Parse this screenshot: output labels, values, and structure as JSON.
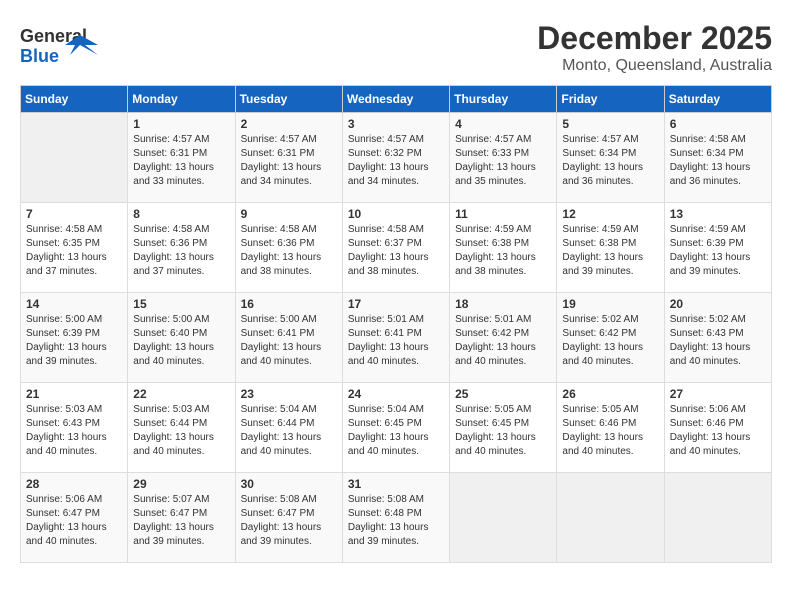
{
  "header": {
    "logo_line1": "General",
    "logo_line2": "Blue",
    "month": "December 2025",
    "location": "Monto, Queensland, Australia"
  },
  "weekdays": [
    "Sunday",
    "Monday",
    "Tuesday",
    "Wednesday",
    "Thursday",
    "Friday",
    "Saturday"
  ],
  "weeks": [
    [
      {
        "day": "",
        "info": ""
      },
      {
        "day": "1",
        "info": "Sunrise: 4:57 AM\nSunset: 6:31 PM\nDaylight: 13 hours\nand 33 minutes."
      },
      {
        "day": "2",
        "info": "Sunrise: 4:57 AM\nSunset: 6:31 PM\nDaylight: 13 hours\nand 34 minutes."
      },
      {
        "day": "3",
        "info": "Sunrise: 4:57 AM\nSunset: 6:32 PM\nDaylight: 13 hours\nand 34 minutes."
      },
      {
        "day": "4",
        "info": "Sunrise: 4:57 AM\nSunset: 6:33 PM\nDaylight: 13 hours\nand 35 minutes."
      },
      {
        "day": "5",
        "info": "Sunrise: 4:57 AM\nSunset: 6:34 PM\nDaylight: 13 hours\nand 36 minutes."
      },
      {
        "day": "6",
        "info": "Sunrise: 4:58 AM\nSunset: 6:34 PM\nDaylight: 13 hours\nand 36 minutes."
      }
    ],
    [
      {
        "day": "7",
        "info": "Sunrise: 4:58 AM\nSunset: 6:35 PM\nDaylight: 13 hours\nand 37 minutes."
      },
      {
        "day": "8",
        "info": "Sunrise: 4:58 AM\nSunset: 6:36 PM\nDaylight: 13 hours\nand 37 minutes."
      },
      {
        "day": "9",
        "info": "Sunrise: 4:58 AM\nSunset: 6:36 PM\nDaylight: 13 hours\nand 38 minutes."
      },
      {
        "day": "10",
        "info": "Sunrise: 4:58 AM\nSunset: 6:37 PM\nDaylight: 13 hours\nand 38 minutes."
      },
      {
        "day": "11",
        "info": "Sunrise: 4:59 AM\nSunset: 6:38 PM\nDaylight: 13 hours\nand 38 minutes."
      },
      {
        "day": "12",
        "info": "Sunrise: 4:59 AM\nSunset: 6:38 PM\nDaylight: 13 hours\nand 39 minutes."
      },
      {
        "day": "13",
        "info": "Sunrise: 4:59 AM\nSunset: 6:39 PM\nDaylight: 13 hours\nand 39 minutes."
      }
    ],
    [
      {
        "day": "14",
        "info": "Sunrise: 5:00 AM\nSunset: 6:39 PM\nDaylight: 13 hours\nand 39 minutes."
      },
      {
        "day": "15",
        "info": "Sunrise: 5:00 AM\nSunset: 6:40 PM\nDaylight: 13 hours\nand 40 minutes."
      },
      {
        "day": "16",
        "info": "Sunrise: 5:00 AM\nSunset: 6:41 PM\nDaylight: 13 hours\nand 40 minutes."
      },
      {
        "day": "17",
        "info": "Sunrise: 5:01 AM\nSunset: 6:41 PM\nDaylight: 13 hours\nand 40 minutes."
      },
      {
        "day": "18",
        "info": "Sunrise: 5:01 AM\nSunset: 6:42 PM\nDaylight: 13 hours\nand 40 minutes."
      },
      {
        "day": "19",
        "info": "Sunrise: 5:02 AM\nSunset: 6:42 PM\nDaylight: 13 hours\nand 40 minutes."
      },
      {
        "day": "20",
        "info": "Sunrise: 5:02 AM\nSunset: 6:43 PM\nDaylight: 13 hours\nand 40 minutes."
      }
    ],
    [
      {
        "day": "21",
        "info": "Sunrise: 5:03 AM\nSunset: 6:43 PM\nDaylight: 13 hours\nand 40 minutes."
      },
      {
        "day": "22",
        "info": "Sunrise: 5:03 AM\nSunset: 6:44 PM\nDaylight: 13 hours\nand 40 minutes."
      },
      {
        "day": "23",
        "info": "Sunrise: 5:04 AM\nSunset: 6:44 PM\nDaylight: 13 hours\nand 40 minutes."
      },
      {
        "day": "24",
        "info": "Sunrise: 5:04 AM\nSunset: 6:45 PM\nDaylight: 13 hours\nand 40 minutes."
      },
      {
        "day": "25",
        "info": "Sunrise: 5:05 AM\nSunset: 6:45 PM\nDaylight: 13 hours\nand 40 minutes."
      },
      {
        "day": "26",
        "info": "Sunrise: 5:05 AM\nSunset: 6:46 PM\nDaylight: 13 hours\nand 40 minutes."
      },
      {
        "day": "27",
        "info": "Sunrise: 5:06 AM\nSunset: 6:46 PM\nDaylight: 13 hours\nand 40 minutes."
      }
    ],
    [
      {
        "day": "28",
        "info": "Sunrise: 5:06 AM\nSunset: 6:47 PM\nDaylight: 13 hours\nand 40 minutes."
      },
      {
        "day": "29",
        "info": "Sunrise: 5:07 AM\nSunset: 6:47 PM\nDaylight: 13 hours\nand 39 minutes."
      },
      {
        "day": "30",
        "info": "Sunrise: 5:08 AM\nSunset: 6:47 PM\nDaylight: 13 hours\nand 39 minutes."
      },
      {
        "day": "31",
        "info": "Sunrise: 5:08 AM\nSunset: 6:48 PM\nDaylight: 13 hours\nand 39 minutes."
      },
      {
        "day": "",
        "info": ""
      },
      {
        "day": "",
        "info": ""
      },
      {
        "day": "",
        "info": ""
      }
    ]
  ]
}
